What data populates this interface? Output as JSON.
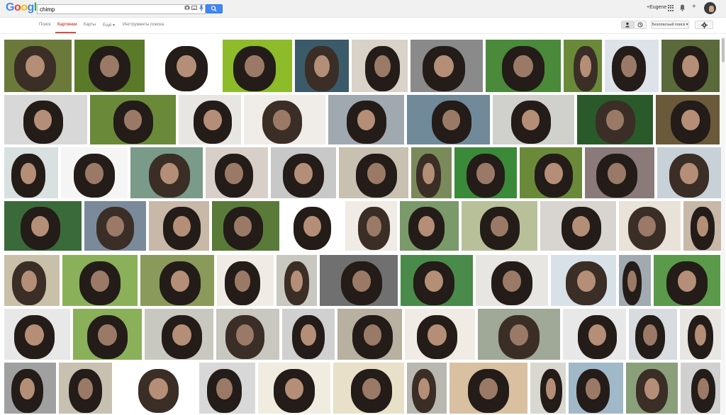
{
  "header": {
    "logo_letters": [
      {
        "ch": "G",
        "color": "#4285f4"
      },
      {
        "ch": "o",
        "color": "#ea4335"
      },
      {
        "ch": "o",
        "color": "#fbbc05"
      },
      {
        "ch": "g",
        "color": "#4285f4"
      },
      {
        "ch": "l",
        "color": "#34a853"
      },
      {
        "ch": "e",
        "color": "#ea4335"
      }
    ],
    "search_value": "chimp",
    "user_label": "+Eugene"
  },
  "nav": {
    "items": [
      "Поиск",
      "Картинки",
      "Карты",
      "Ещё ▾",
      "Инструменты поиска"
    ],
    "active": "Картинки",
    "safe_search": "Безопасный поиск ▾"
  },
  "icons": [
    "google-logo",
    "camera-icon",
    "keyboard-icon",
    "mic-icon",
    "search-icon",
    "apps-icon",
    "bell-icon",
    "plus-icon",
    "avatar",
    "person-icon",
    "clock-icon",
    "gear-icon"
  ],
  "colors": {
    "accent": "#dd4b39",
    "search_blue": "#4285f4"
  },
  "image_rows": [
    [
      "#6b7a3a",
      "#5a7a2a",
      "#ffffff",
      "#8dbb2a",
      "#3b5a6a",
      "#d8d2c8",
      "#8a8a8a",
      "#4a8a3a",
      "#6a8a3a",
      "#dde3e8",
      "#5a6a3a"
    ],
    [
      "#d8d8d8",
      "#6a8a3a",
      "#e8e6e2",
      "#f0ece8",
      "#a0a8b0",
      "#708a9a",
      "#d0d0cc",
      "#2a5a2a",
      "#6a5a3a"
    ],
    [
      "#d8e0e0",
      "#f5f5f5",
      "#7a9a8a",
      "#d8d0c8",
      "#c8c8c8",
      "#c8c0b0",
      "#7a8a5a",
      "#3a8a3a",
      "#6a8a3a",
      "#8a7a7a",
      "#c8d0d8"
    ],
    [
      "#3a6a3a",
      "#7a8a9a",
      "#c8b8a8",
      "#5a7a3a",
      "#ffffff",
      "#f0ebe5",
      "#7a9a6a",
      "#b8c09a",
      "#d8d4d0",
      "#e8e2d8",
      "#c8b8a8"
    ],
    [
      "#c8c0a8",
      "#8ab05a",
      "#8a9a5a",
      "#f0ebe5",
      "#c8c8c0",
      "#707070",
      "#4a8a4a",
      "#e8e6e2",
      "#d8e0e8",
      "#a0aab0",
      "#5a9a4a"
    ],
    [
      "#e8e8e8",
      "#8ab05a",
      "#c8c8c0",
      "#c8c8c0",
      "#d0d0d0",
      "#b8b0a0",
      "#f0ebe5",
      "#a0a898",
      "#e8e8e8",
      "#d8dce0",
      "#e8e6e2"
    ],
    [
      "#a0a0a0",
      "#c8c0b0",
      "#ffffff",
      "#d8d8d8",
      "#f0ece0",
      "#e8e0c8",
      "#b8b8b0",
      "#d8c0a0",
      "#d8d8d0",
      "#a0b8c8",
      "#8aa07a",
      "#d0d0d0"
    ]
  ]
}
